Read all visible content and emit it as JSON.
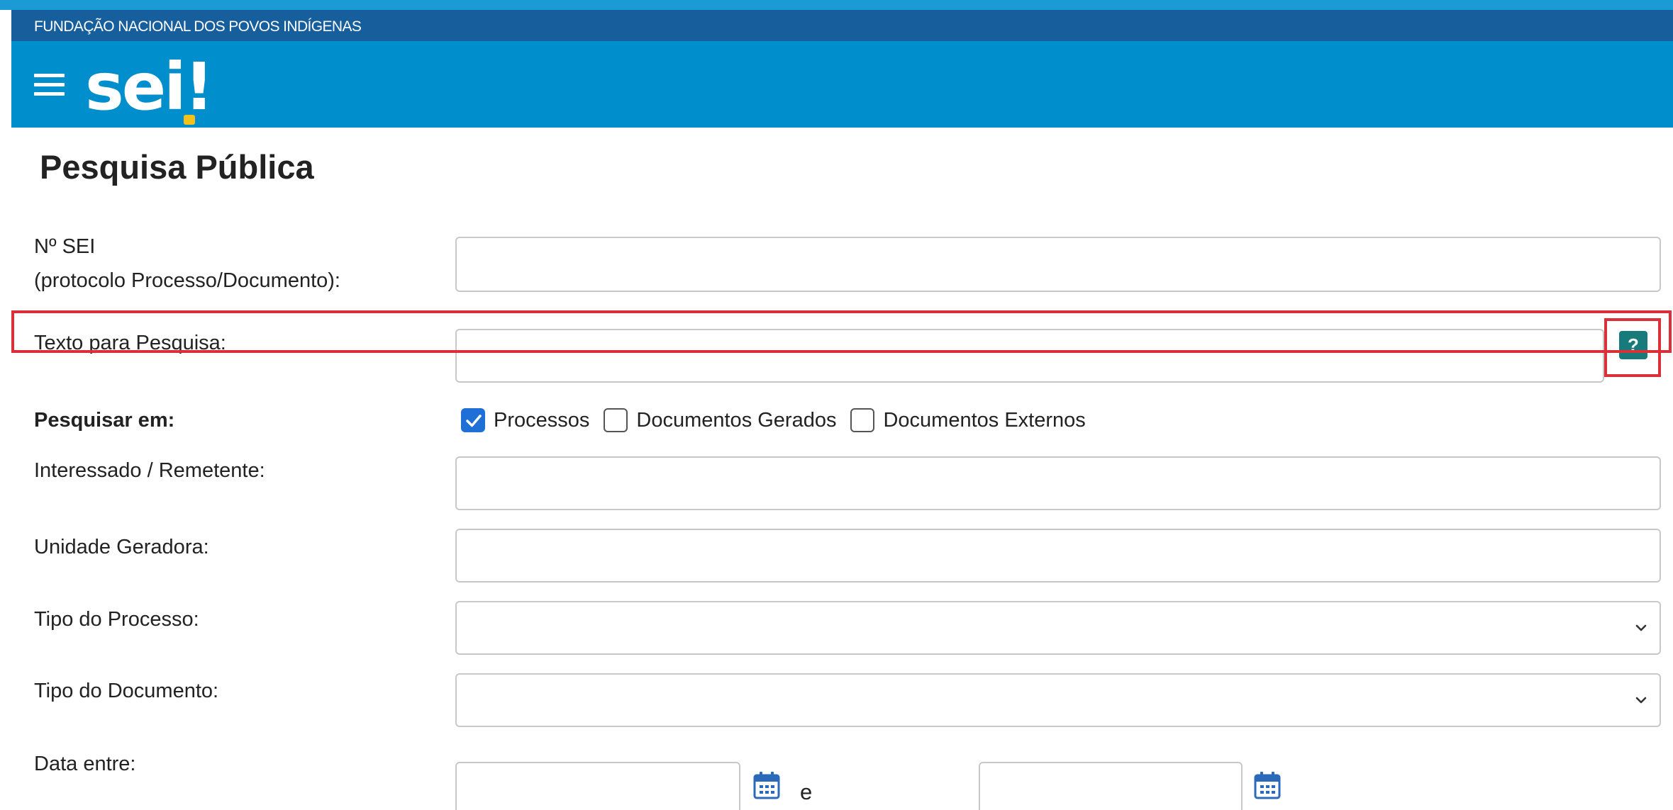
{
  "header": {
    "org_name": "FUNDAÇÃO NACIONAL DOS POVOS INDÍGENAS",
    "logo_text": "sei",
    "logo_mark": "!",
    "menu_icon": "hamburger-menu-icon",
    "colors": {
      "bar": "#175e9c",
      "header": "#008ecc",
      "logo_dot": "#f2c21a"
    }
  },
  "page": {
    "title": "Pesquisa Pública"
  },
  "form": {
    "sei_number": {
      "label_line1": "Nº SEI",
      "label_line2": "(protocolo Processo/Documento):",
      "value": ""
    },
    "search_text": {
      "label": "Texto para Pesquisa:",
      "value": "",
      "help_label": "?"
    },
    "search_in": {
      "label": "Pesquisar em:",
      "options": [
        {
          "label": "Processos",
          "checked": true
        },
        {
          "label": "Documentos Gerados",
          "checked": false
        },
        {
          "label": "Documentos Externos",
          "checked": false
        }
      ]
    },
    "interested": {
      "label": "Interessado / Remetente:",
      "value": ""
    },
    "unit": {
      "label": "Unidade Geradora:",
      "value": ""
    },
    "process_type": {
      "label": "Tipo do Processo:",
      "value": ""
    },
    "document_type": {
      "label": "Tipo do Documento:",
      "value": ""
    },
    "date_range": {
      "label": "Data entre:",
      "separator": "e",
      "from": "",
      "to": "",
      "icon": "calendar-icon"
    }
  },
  "highlight_color": "#d9303a"
}
